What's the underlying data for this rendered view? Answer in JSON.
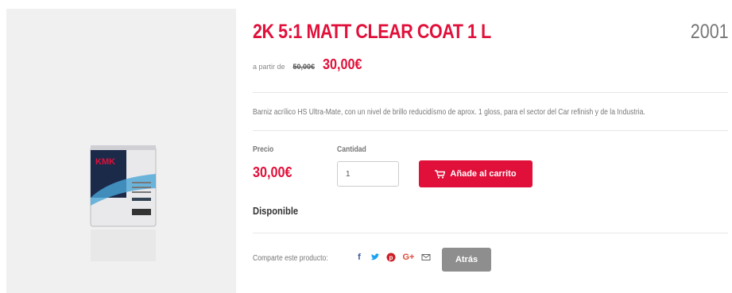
{
  "product": {
    "title": "2K 5:1 MATT CLEAR COAT 1 L",
    "sku": "2001",
    "from_label": "a partir de",
    "old_price": "50,00€",
    "price": "30,00€",
    "description": "Barniz acrílico HS Ultra-Mate, con un nivel de brillo reducidísmo de aprox. 1 gloss, para el sector del Car refinish y de la Industria.",
    "image_brand": "KMK"
  },
  "purchase": {
    "price_label": "Precio",
    "price_value": "30,00€",
    "quantity_label": "Cantidad",
    "quantity_value": "1",
    "cart_button": "Añade al carrito",
    "availability": "Disponible"
  },
  "share": {
    "label": "Comparte este producto:",
    "icons": [
      "facebook-icon",
      "twitter-icon",
      "pinterest-icon",
      "google-plus-icon",
      "email-icon"
    ],
    "back_button": "Atrás"
  },
  "colors": {
    "accent": "#e0103a",
    "back_button": "#8e8e8e",
    "image_background": "#f0f0f0"
  }
}
